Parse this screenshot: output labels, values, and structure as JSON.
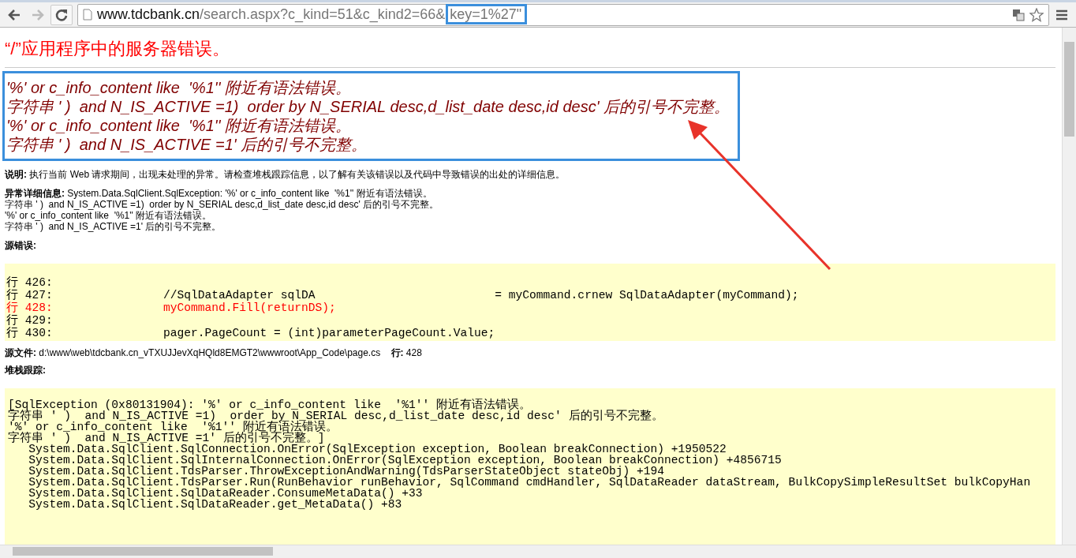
{
  "browser": {
    "url_host": "www.tdcbank.cn",
    "url_path": "/search.aspx?c_kind=51&c_kind2=66&",
    "url_marked": "key=1%27\""
  },
  "page": {
    "title": "“/”应用程序中的服务器错误。",
    "error_lines": [
      "'%' or c_info_content like  '%1'' 附近有语法错误。",
      "字符串 ' )  and N_IS_ACTIVE =1)  order by N_SERIAL desc,d_list_date desc,id desc' 后的引号不完整。",
      "'%' or c_info_content like  '%1'' 附近有语法错误。",
      "字符串 ' )  and N_IS_ACTIVE =1' 后的引号不完整。"
    ],
    "description": "**说明:** 执行当前 Web 请求期间，出现未处理的异常。请检查堆栈跟踪信息，以了解有关该错误以及代码中导致错误的出处的详细信息。",
    "exception_lines": [
      "**异常详细信息:** System.Data.SqlClient.SqlException: '%' or c_info_content like  '%1'' 附近有语法错误。",
      "字符串 ' )  and N_IS_ACTIVE =1)  order by N_SERIAL desc,d_list_date desc,id desc' 后的引号不完整。",
      "'%' or c_info_content like  '%1'' 附近有语法错误。",
      "字符串 ' )  and N_IS_ACTIVE =1' 后的引号不完整。"
    ],
    "source_error_label": "源错误:",
    "source_lines": [
      {
        "text": "行 426:",
        "highlighted": false
      },
      {
        "text": "行 427:                //SqlDataAdapter sqlDA                          = myCommand.crnew SqlDataAdapter(myCommand);",
        "highlighted": false
      },
      {
        "text": "行 428:                myCommand.Fill(returnDS);",
        "highlighted": true
      },
      {
        "text": "行 429:",
        "highlighted": false
      },
      {
        "text": "行 430:                pager.PageCount = (int)parameterPageCount.Value;",
        "highlighted": false
      }
    ],
    "source_file": "**源文件:** d:\\www\\web\\tdcbank.cn_vTXUJJevXqHQld8EMGT2\\wwwroot\\App_Code\\page.cs    **行:** 428",
    "stack_label": "堆栈跟踪:",
    "stack_lines": [
      "[SqlException (0x80131904): '%' or c_info_content like  '%1'' 附近有语法错误。",
      "字符串 ' )  and N_IS_ACTIVE =1)  order by N_SERIAL desc,d_list_date desc,id desc' 后的引号不完整。",
      "'%' or c_info_content like  '%1'' 附近有语法错误。",
      "字符串 ' )  and N_IS_ACTIVE =1' 后的引号不完整。]",
      "   System.Data.SqlClient.SqlConnection.OnError(SqlException exception, Boolean breakConnection) +1950522",
      "   System.Data.SqlClient.SqlInternalConnection.OnError(SqlException exception, Boolean breakConnection) +4856715",
      "   System.Data.SqlClient.TdsParser.ThrowExceptionAndWarning(TdsParserStateObject stateObj) +194",
      "   System.Data.SqlClient.TdsParser.Run(RunBehavior runBehavior, SqlCommand cmdHandler, SqlDataReader dataStream, BulkCopySimpleResultSet bulkCopyHan",
      "   System.Data.SqlClient.SqlDataReader.ConsumeMetaData() +33",
      "   System.Data.SqlClient.SqlDataReader.get_MetaData() +83"
    ]
  }
}
